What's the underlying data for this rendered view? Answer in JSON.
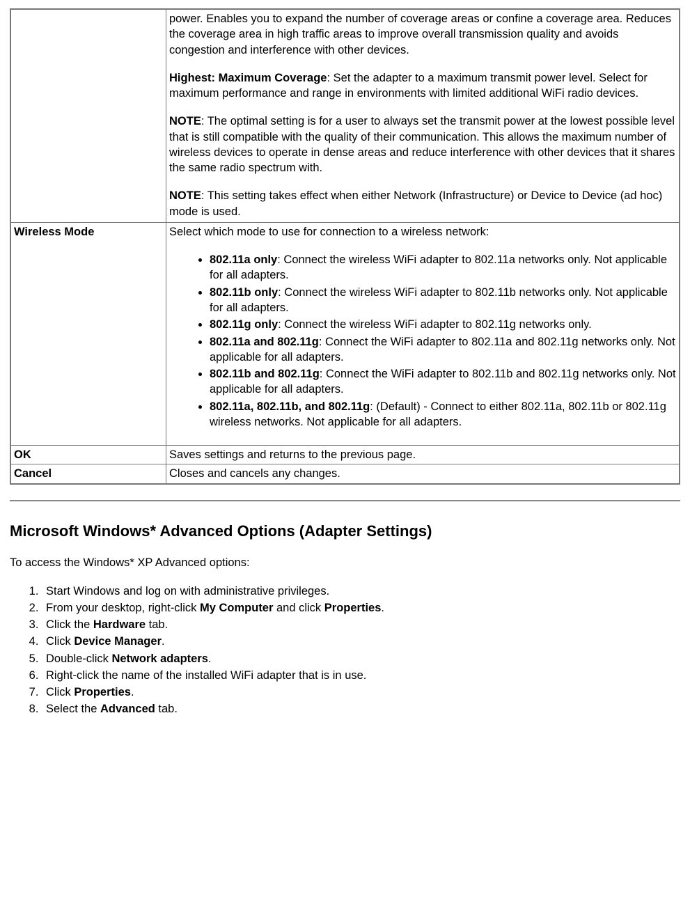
{
  "table": {
    "row1": {
      "label": "",
      "para1": "power. Enables you to expand the number of coverage areas or confine a coverage area. Reduces the coverage area in high traffic areas to improve overall transmission quality and avoids congestion and interference with other devices.",
      "para2_bold": "Highest: Maximum Coverage",
      "para2_rest": ": Set the adapter to a maximum transmit power level. Select for maximum performance and range in environments with limited additional WiFi radio devices.",
      "para3_bold": "NOTE",
      "para3_rest": ": The optimal setting is for a user to always set the transmit power at the lowest possible level that is still compatible with the quality of their communication. This allows the maximum number of wireless devices to operate in dense areas and reduce interference with other devices that it shares the same radio spectrum with.",
      "para4_bold": "NOTE",
      "para4_rest": ": This setting takes effect when either Network (Infrastructure) or Device to Device (ad hoc) mode is used."
    },
    "row2": {
      "label": "Wireless Mode",
      "intro": "Select which mode to use for connection to a wireless network:",
      "items": [
        {
          "bold": "802.11a only",
          "rest": ": Connect the wireless WiFi adapter to 802.11a networks only. Not applicable for all adapters."
        },
        {
          "bold": "802.11b only",
          "rest": ": Connect the wireless WiFi adapter to 802.11b networks only. Not applicable for all adapters."
        },
        {
          "bold": "802.11g only",
          "rest": ": Connect the wireless WiFi adapter to 802.11g networks only."
        },
        {
          "bold": "802.11a and 802.11g",
          "rest": ": Connect the WiFi adapter to 802.11a and 802.11g networks only. Not applicable for all adapters."
        },
        {
          "bold": "802.11b and 802.11g",
          "rest": ": Connect the WiFi adapter to 802.11b and 802.11g networks only. Not applicable for all adapters."
        },
        {
          "bold": "802.11a, 802.11b, and 802.11g",
          "rest": ": (Default) - Connect to either 802.11a, 802.11b or 802.11g wireless networks. Not applicable for all adapters."
        }
      ]
    },
    "row3": {
      "label": "OK",
      "desc": "Saves settings and returns to the previous page."
    },
    "row4": {
      "label": "Cancel",
      "desc": "Closes and cancels any changes."
    }
  },
  "section": {
    "heading": "Microsoft Windows* Advanced Options (Adapter Settings)",
    "intro": "To access the Windows* XP Advanced options:",
    "steps": [
      {
        "pre": "Start Windows and log on with administrative privileges."
      },
      {
        "pre": "From your desktop, right-click ",
        "b1": "My Computer",
        "mid": " and click ",
        "b2": "Properties",
        "post": "."
      },
      {
        "pre": "Click the ",
        "b1": "Hardware",
        "post": " tab."
      },
      {
        "pre": "Click ",
        "b1": "Device Manager",
        "post": "."
      },
      {
        "pre": "Double-click ",
        "b1": "Network adapters",
        "post": "."
      },
      {
        "pre": "Right-click the name of the installed WiFi adapter that is in use."
      },
      {
        "pre": "Click ",
        "b1": "Properties",
        "post": "."
      },
      {
        "pre": "Select the ",
        "b1": "Advanced",
        "post": " tab."
      }
    ]
  }
}
